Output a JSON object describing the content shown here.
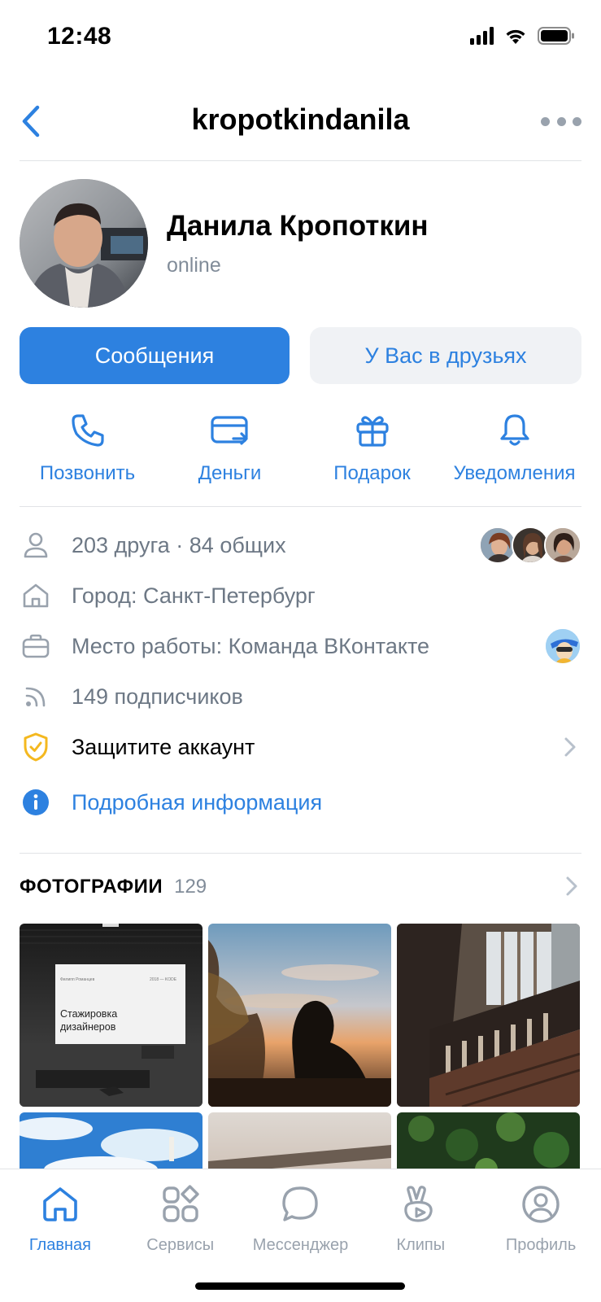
{
  "status_bar": {
    "time": "12:48"
  },
  "nav": {
    "title": "kropotkindanila"
  },
  "profile": {
    "name": "Данила Кропоткин",
    "status": "online"
  },
  "buttons": {
    "primary": "Сообщения",
    "secondary": "У Вас в друзьях"
  },
  "actions": [
    {
      "label": "Позвонить",
      "icon": "phone-icon"
    },
    {
      "label": "Деньги",
      "icon": "money-transfer-icon"
    },
    {
      "label": "Подарок",
      "icon": "gift-icon"
    },
    {
      "label": "Уведомления",
      "icon": "bell-icon"
    }
  ],
  "info": {
    "friends": "203 друга · 84 общих",
    "city": "Город: Санкт-Петербург",
    "work": "Место работы: Команда ВКонтакте",
    "followers": "149 подписчиков",
    "protect": "Защитите аккаунт",
    "details": "Подробная информация"
  },
  "photos": {
    "title": "ФОТОГРАФИИ",
    "count": "129",
    "slide_text_line1": "Стажировка",
    "slide_text_line2": "дизайнеров",
    "slide_header_left": "Филипп Романцев",
    "slide_header_right": "2018 — KODE"
  },
  "tabs": [
    {
      "label": "Главная",
      "icon": "home-icon",
      "active": true
    },
    {
      "label": "Сервисы",
      "icon": "services-icon",
      "active": false
    },
    {
      "label": "Мессенджер",
      "icon": "messenger-icon",
      "active": false
    },
    {
      "label": "Клипы",
      "icon": "clips-icon",
      "active": false
    },
    {
      "label": "Профиль",
      "icon": "profile-icon",
      "active": false
    }
  ],
  "colors": {
    "accent": "#2d81e0",
    "secondary_text": "#818c99",
    "icon_gray": "#99a2ad",
    "warning": "#f4b81f",
    "button_secondary_bg": "#f0f2f5"
  }
}
